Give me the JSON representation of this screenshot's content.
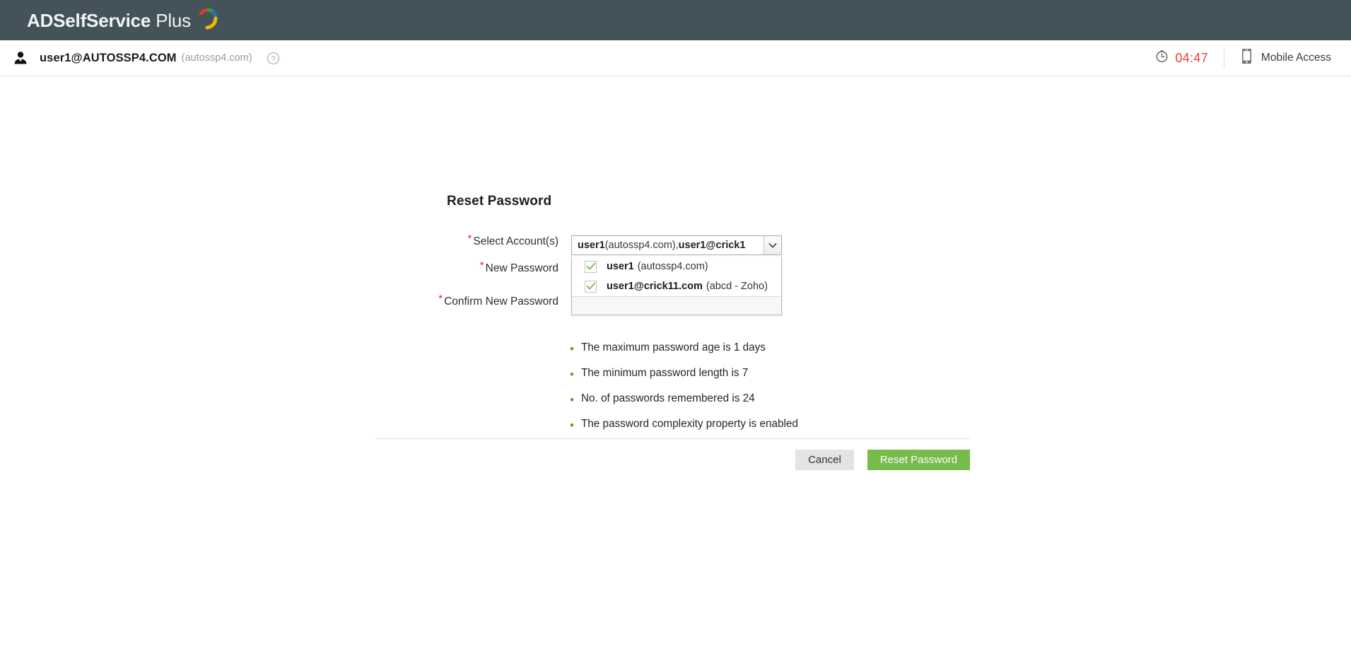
{
  "brand": {
    "name_bold": "ADSelf",
    "name_mid": "Service",
    "name_thin": " Plus",
    "full": "ADSelfService Plus"
  },
  "userbar": {
    "user": "user1@AUTOSSP4.COM",
    "domain": "(autossp4.com)",
    "help_tooltip": "?",
    "timer": "04:47",
    "mobile_access": "Mobile Access"
  },
  "page": {
    "title": "Reset Password"
  },
  "form": {
    "required_mark": "*",
    "fields": [
      {
        "label": "Select Account(s)",
        "type": "multiselect"
      },
      {
        "label": "New Password",
        "type": "password",
        "value": ""
      },
      {
        "label": "Confirm New Password",
        "type": "password",
        "value": ""
      }
    ],
    "select_accounts": {
      "display_value_1": "user1",
      "display_value_1_sub": " (autossp4.com), ",
      "display_value_2": "user1@crick1",
      "options": [
        {
          "name": "user1",
          "detail": "(autossp4.com)",
          "checked": true
        },
        {
          "name": "user1@crick11.com",
          "detail": "(abcd - Zoho)",
          "checked": true
        }
      ]
    }
  },
  "policy": {
    "items": [
      "The maximum password age is 1 days",
      "The minimum password length is 7",
      "No. of passwords remembered is 24",
      "The password complexity property is enabled"
    ]
  },
  "actions": {
    "cancel_label": "Cancel",
    "submit_label": "Reset Password"
  },
  "colors": {
    "header_bg": "#44525a",
    "accent_green": "#77bb4b",
    "timer_red": "#e8413a",
    "required_red": "#ec2b1f",
    "bullet_green": "#5ea32e"
  }
}
